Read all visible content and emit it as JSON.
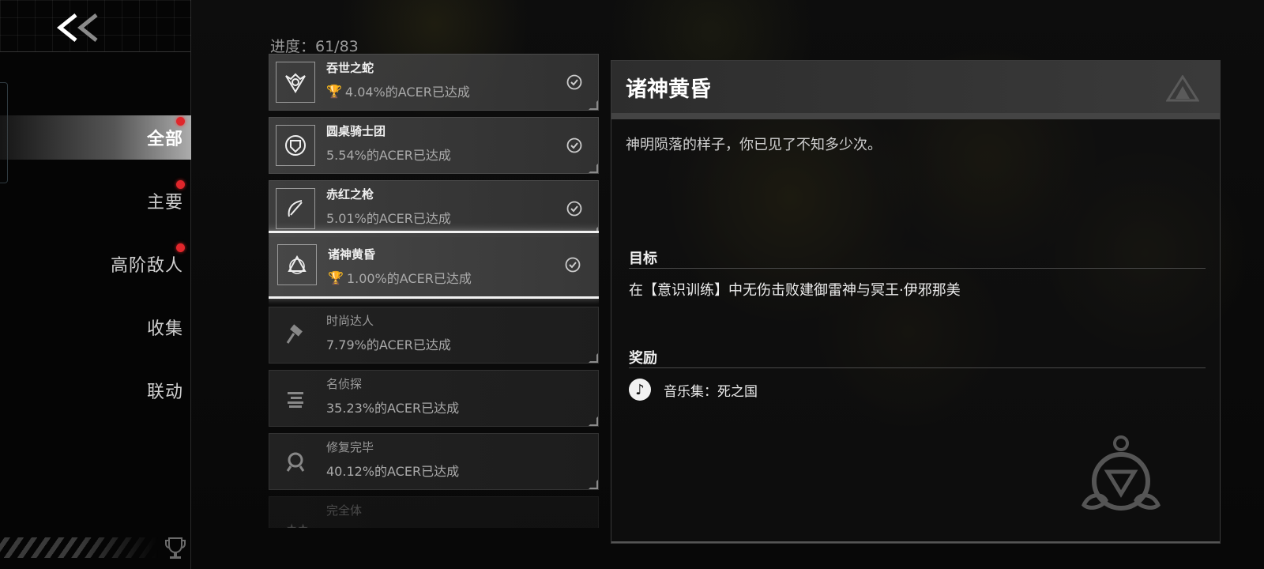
{
  "sidebar": {
    "back_label": "<<",
    "items": [
      {
        "label": "全部",
        "active": true,
        "badge": true
      },
      {
        "label": "主要",
        "active": false,
        "badge": true
      },
      {
        "label": "高阶敌人",
        "active": false,
        "badge": true
      },
      {
        "label": "收集",
        "active": false,
        "badge": false
      },
      {
        "label": "联动",
        "active": false,
        "badge": false
      }
    ]
  },
  "progress": {
    "label": "进度：61/83"
  },
  "achievements": [
    {
      "name": "吞世之蛇",
      "pct": "4.04%的ACER已达成",
      "trophy": true,
      "completed": true,
      "icon": "serpent-icon"
    },
    {
      "name": "圆桌骑士团",
      "pct": "5.54%的ACER已达成",
      "trophy": false,
      "completed": true,
      "icon": "knight-shield-icon"
    },
    {
      "name": "赤红之枪",
      "pct": "5.01%的ACER已达成",
      "trophy": false,
      "completed": true,
      "icon": "spear-icon"
    },
    {
      "name": "诸神黄昏",
      "pct": "1.00%的ACER已达成",
      "trophy": true,
      "completed": true,
      "icon": "triquetra-icon"
    },
    {
      "name": "时尚达人",
      "pct": "7.79%的ACER已达成",
      "trophy": false,
      "completed": false,
      "icon": "hammer-icon"
    },
    {
      "name": "名侦探",
      "pct": "35.23%的ACER已达成",
      "trophy": false,
      "completed": false,
      "icon": "detective-icon"
    },
    {
      "name": "修复完毕",
      "pct": "40.12%的ACER已达成",
      "trophy": false,
      "completed": false,
      "icon": "repair-icon"
    },
    {
      "name": "完全体",
      "pct": "",
      "trophy": false,
      "completed": false,
      "icon": "stars-icon"
    }
  ],
  "detail": {
    "title": "诸神黄昏",
    "description": "神明陨落的样子，你已见了不知多少次。",
    "goal_label": "目标",
    "goal_text": "在【意识训练】中无伤击败建御雷神与冥王·伊邪那美",
    "reward_label": "奖励",
    "reward_text": "音乐集：死之国"
  },
  "colors": {
    "badge": "#e0262b",
    "selected_border": "#f2f2f2"
  }
}
